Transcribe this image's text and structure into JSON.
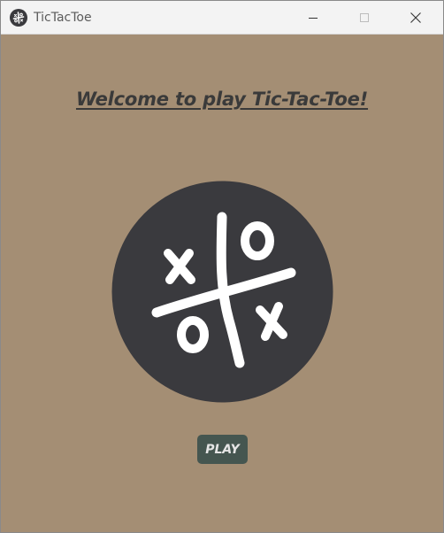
{
  "window": {
    "title": "TicTacToe"
  },
  "main": {
    "headline": "Welcome to play Tic-Tac-Toe!",
    "play_label": "PLAY"
  },
  "colors": {
    "background": "#a48e74",
    "logo_circle": "#3a3a3e",
    "button": "#455650",
    "titlebar": "#f3f3f3"
  },
  "icons": {
    "app": "tictactoe-icon",
    "minimize": "minimize-icon",
    "maximize": "maximize-icon",
    "close": "close-icon",
    "logo": "tictactoe-logo"
  }
}
